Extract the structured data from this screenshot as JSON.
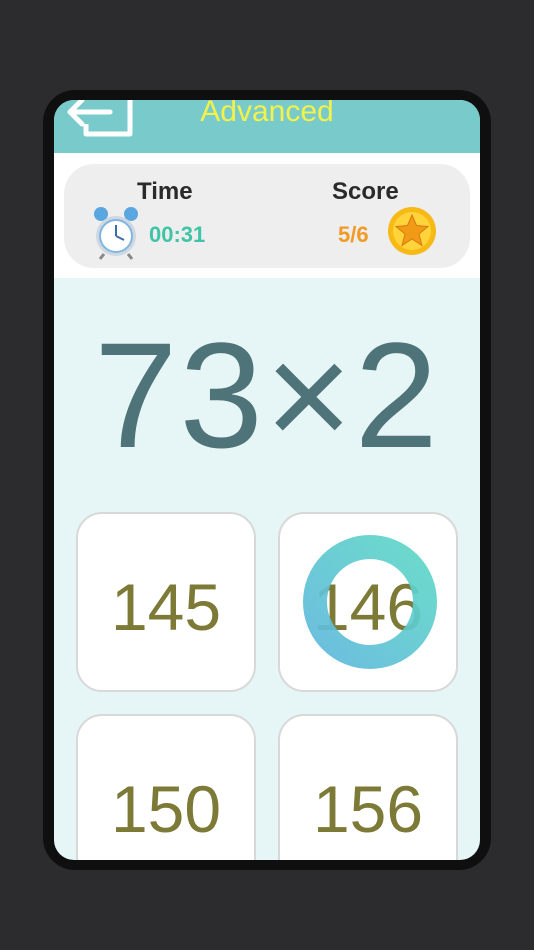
{
  "header": {
    "title": "Advanced",
    "back_icon": "back-arrow-icon",
    "colors": {
      "bar": "#79cbcb",
      "title": "#f2f24a"
    }
  },
  "stats": {
    "time_label": "Time",
    "time_value": "00:31",
    "score_label": "Score",
    "score_value": "5/6",
    "colors": {
      "time": "#3fc4a8",
      "score": "#f39a25"
    }
  },
  "question": {
    "text": "73×2"
  },
  "answers": [
    {
      "label": "145",
      "state": "idle"
    },
    {
      "label": "146",
      "state": "selected-loading"
    },
    {
      "label": "150",
      "state": "idle"
    },
    {
      "label": "156",
      "state": "idle"
    }
  ],
  "colors": {
    "answer_text": "#7c7a36",
    "question": "#4e7378",
    "background": "#e6f5f5"
  }
}
